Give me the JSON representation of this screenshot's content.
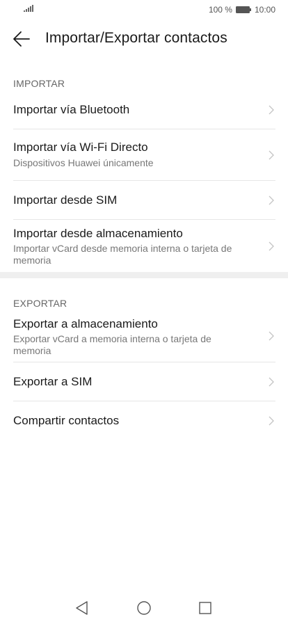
{
  "status_bar": {
    "battery_text": "100 %",
    "time": "10:00"
  },
  "header": {
    "title": "Importar/Exportar contactos"
  },
  "sections": [
    {
      "header": "IMPORTAR",
      "items": [
        {
          "title": "Importar vía Bluetooth",
          "subtitle": ""
        },
        {
          "title": "Importar vía Wi-Fi Directo",
          "subtitle": "Dispositivos Huawei únicamente"
        },
        {
          "title": "Importar desde SIM",
          "subtitle": ""
        },
        {
          "title": "Importar desde almacenamiento",
          "subtitle": "Importar vCard desde memoria interna o tarjeta de memoria"
        }
      ]
    },
    {
      "header": "EXPORTAR",
      "items": [
        {
          "title": "Exportar a almacenamiento",
          "subtitle": "Exportar vCard a memoria interna o tarjeta de memoria"
        },
        {
          "title": "Exportar a SIM",
          "subtitle": ""
        },
        {
          "title": "Compartir contactos",
          "subtitle": ""
        }
      ]
    }
  ],
  "icons": {
    "back": "back-arrow-icon",
    "chevron": "chevron-right-icon",
    "nav_back": "triangle-back-icon",
    "nav_home": "circle-home-icon",
    "nav_recents": "square-recents-icon"
  },
  "colors": {
    "divider": "#e6e6e6",
    "section_gap": "#efefef",
    "chevron": "#c4c4c4"
  }
}
